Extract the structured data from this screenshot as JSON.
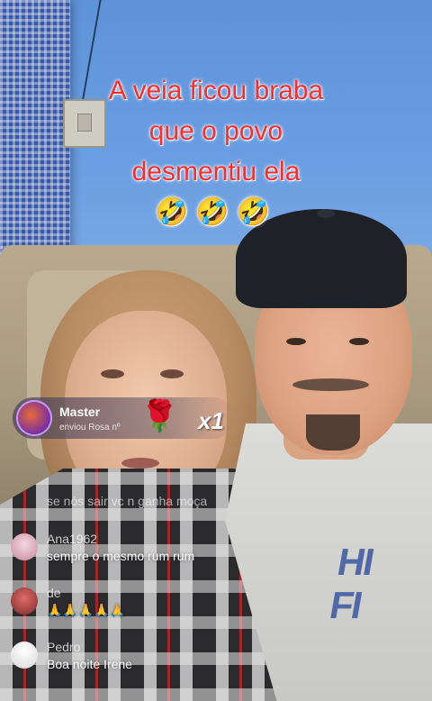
{
  "caption": {
    "lines": [
      "A veia ficou braba",
      "que o povo",
      "desmentiu ela"
    ],
    "emojis": "🤣🤣🤣",
    "color": "#ff2a2a"
  },
  "gift": {
    "user": "Master",
    "subtitle": "enviou Rosa nº",
    "icon": "rose-icon",
    "rose_glyph": "🌹",
    "count": "x1"
  },
  "comments": {
    "faded_text": "se nós sair vc n ganha moça",
    "items": [
      {
        "user": "Ana1962",
        "text": "sempre o mesmo rum rum"
      },
      {
        "user": "de",
        "text": "🙏🙏🙏🙏🙏"
      },
      {
        "user": "Pedro",
        "text": "Boa noite Irene"
      }
    ]
  }
}
